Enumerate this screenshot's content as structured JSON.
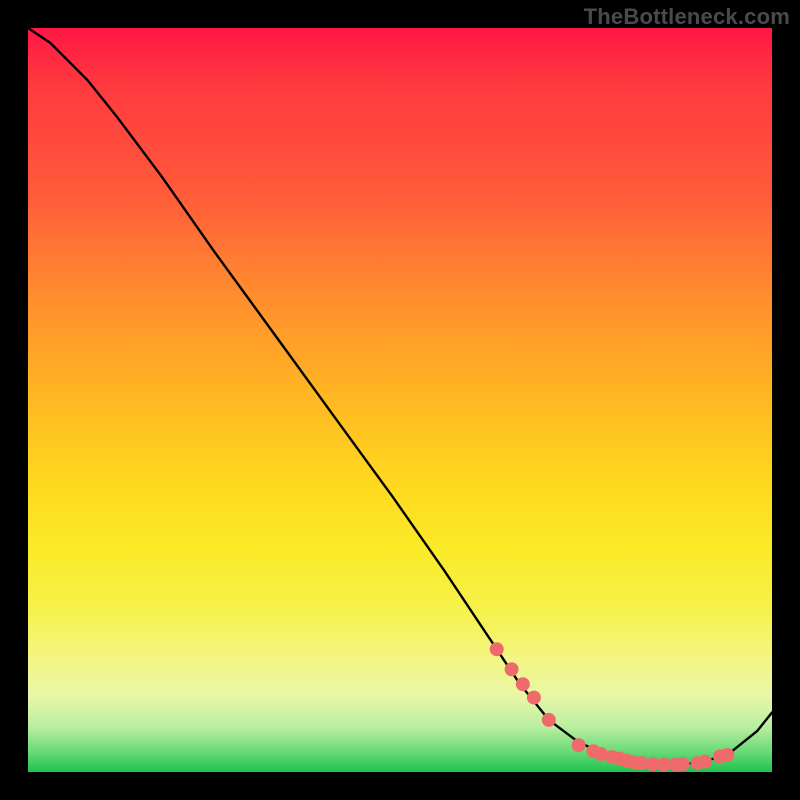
{
  "brand": "TheBottleneck.com",
  "colors": {
    "curve_stroke": "#000000",
    "dot_fill": "#ef6b6b",
    "dot_stroke": "#b94747"
  },
  "chart_data": {
    "type": "line",
    "title": "",
    "xlabel": "",
    "ylabel": "",
    "xlim": [
      0,
      100
    ],
    "ylim": [
      0,
      100
    ],
    "x": [
      0,
      3,
      5,
      8,
      12,
      18,
      25,
      33,
      41,
      49,
      56,
      62,
      66,
      70,
      74,
      78,
      82,
      86,
      90,
      94,
      98,
      100
    ],
    "values": [
      100,
      98,
      96,
      93,
      88,
      80,
      70,
      59,
      48,
      37,
      27,
      18,
      12,
      7,
      4,
      2.2,
      1.3,
      1.0,
      1.2,
      2.3,
      5.5,
      8
    ],
    "dots_x": [
      63,
      65,
      66.5,
      68,
      70,
      74,
      76,
      77,
      78.5,
      79.5,
      80.5,
      81.5,
      82.5,
      84,
      85.5,
      87,
      88,
      90,
      91,
      93,
      94
    ],
    "dots_y": [
      16.5,
      13.8,
      11.8,
      10.0,
      7.0,
      3.6,
      2.8,
      2.4,
      2.0,
      1.8,
      1.5,
      1.3,
      1.2,
      1.05,
      1.0,
      1.0,
      1.05,
      1.2,
      1.4,
      2.1,
      2.3
    ]
  }
}
